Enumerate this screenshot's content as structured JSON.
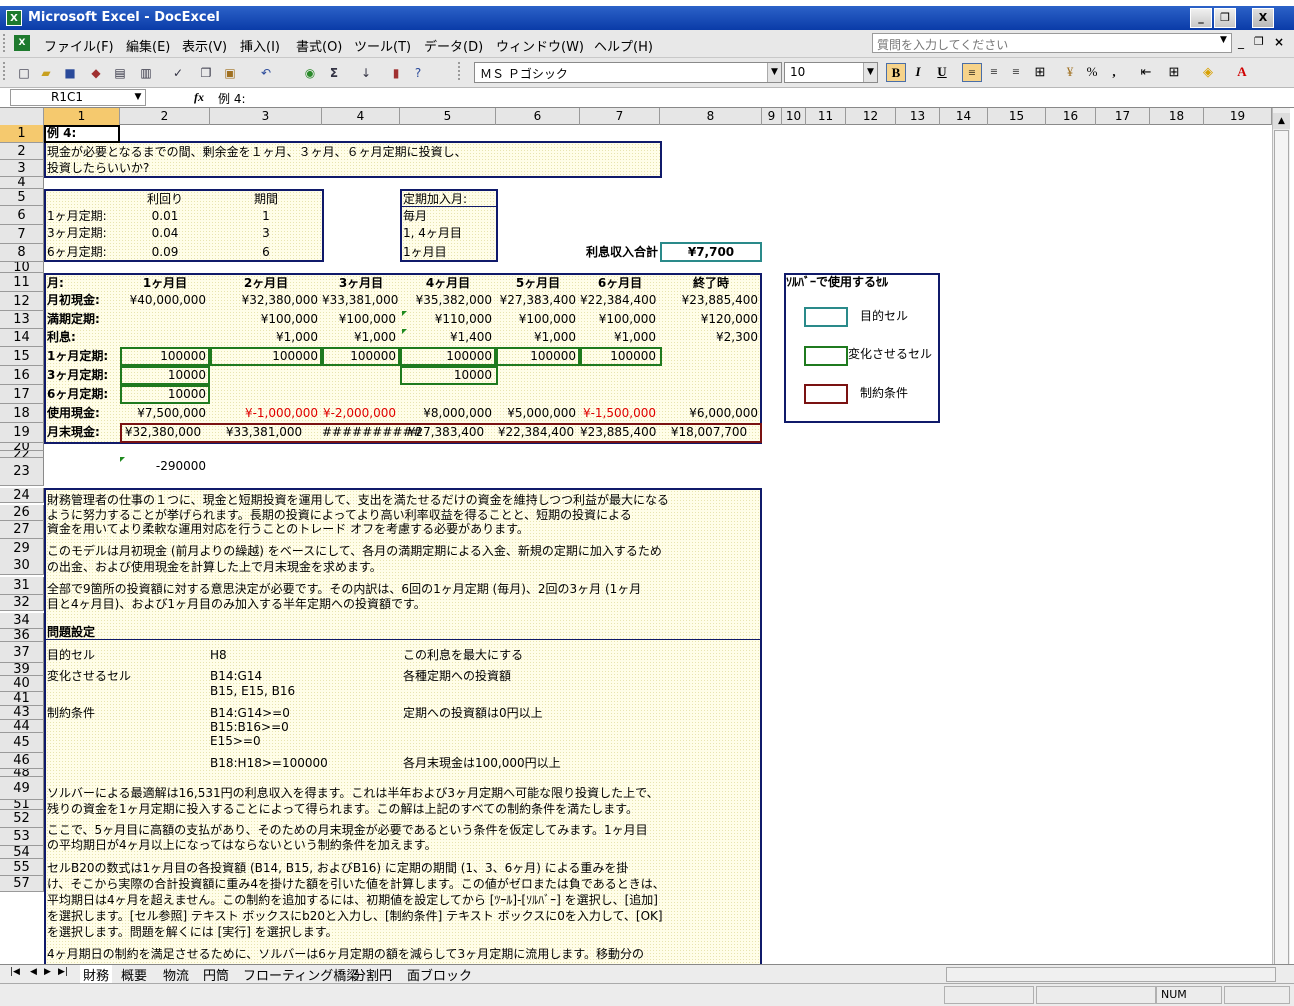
{
  "window": {
    "app_icon": "X",
    "title": "Microsoft Excel - DocExcel",
    "min": "_",
    "restore": "❐",
    "close": "X"
  },
  "menu": {
    "items": [
      "ファイル(F)",
      "編集(E)",
      "表示(V)",
      "挿入(I)",
      "書式(O)",
      "ツール(T)",
      "データ(D)",
      "ウィンドウ(W)",
      "ヘルプ(H)"
    ],
    "help_placeholder": "質問を入力してください",
    "sub_min": "_",
    "sub_restore": "❐",
    "sub_close": "×"
  },
  "toolbar": {
    "font": "ＭＳ Ｐゴシック",
    "size": "10",
    "bold": "B",
    "italic": "I",
    "underline": "U",
    "percent": "%",
    "comma": ","
  },
  "formula": {
    "name_box": "R1C1",
    "fx": "fx",
    "content": "例 4:"
  },
  "columns": [
    "1",
    "2",
    "3",
    "4",
    "5",
    "6",
    "7",
    "8",
    "9",
    "10",
    "11",
    "12",
    "13",
    "14",
    "15",
    "16",
    "17",
    "18",
    "19"
  ],
  "rows": [
    "1",
    "2",
    "3",
    "4",
    "5",
    "6",
    "7",
    "8",
    "10",
    "11",
    "12",
    "13",
    "14",
    "15",
    "16",
    "17",
    "18",
    "19",
    "20",
    "22",
    "23",
    "24",
    "26",
    "27",
    "29",
    "30",
    "31",
    "32",
    "34",
    "36",
    "37",
    "39",
    "40",
    "41",
    "43",
    "44",
    "45",
    "46",
    "48",
    "49",
    "51",
    "52",
    "53",
    "54",
    "55",
    "57"
  ],
  "cells": {
    "r1": "例 4:",
    "r2": "現金が必要となるまでの間、剰余金を１ヶ月、３ヶ月、６ヶ月定期に投資し、",
    "r3": "投資したらいいか?",
    "rate_hdr": "利回り",
    "term_hdr": "期間",
    "r6_lbl": "1ヶ月定期:",
    "r6_rate": "0.01",
    "r6_term": "1",
    "r7_lbl": "3ヶ月定期:",
    "r7_rate": "0.04",
    "r7_term": "3",
    "r8_lbl": "6ヶ月定期:",
    "r8_rate": "0.09",
    "r8_term": "6",
    "join_hdr": "定期加入月:",
    "join1": "毎月",
    "join2": "1, 4ヶ月目",
    "join3": "1ヶ月目",
    "interest_lbl": "利息収入合計",
    "interest_val": "¥7,700",
    "m_hdr": "月:",
    "m1": "1ヶ月目",
    "m2": "2ヶ月目",
    "m3": "3ヶ月目",
    "m4": "4ヶ月目",
    "m5": "5ヶ月目",
    "m6": "6ヶ月目",
    "m7": "終了時",
    "r11": {
      "lbl": "月初現金:",
      "v": [
        "¥40,000,000",
        "¥32,380,000",
        "¥33,381,000",
        "¥35,382,000",
        "¥27,383,400",
        "¥22,384,400",
        "¥23,885,400"
      ]
    },
    "r12": {
      "lbl": "満期定期:",
      "v": [
        "",
        "¥100,000",
        "¥100,000",
        "¥110,000",
        "¥100,000",
        "¥100,000",
        "¥120,000"
      ]
    },
    "r13": {
      "lbl": "利息:",
      "v": [
        "",
        "¥1,000",
        "¥1,000",
        "¥1,400",
        "¥1,000",
        "¥1,000",
        "¥2,300"
      ]
    },
    "r14": {
      "lbl": "1ヶ月定期:",
      "v": [
        "100000",
        "100000",
        "100000",
        "100000",
        "100000",
        "100000"
      ]
    },
    "r15": {
      "lbl": "3ヶ月定期:",
      "v": [
        "10000",
        "10000"
      ]
    },
    "r16": {
      "lbl": "6ヶ月定期:",
      "v": [
        "10000"
      ]
    },
    "r17": {
      "lbl": "使用現金:",
      "v": [
        "¥7,500,000",
        "¥-1,000,000",
        "¥-2,000,000",
        "¥8,000,000",
        "¥5,000,000",
        "¥-1,500,000",
        "¥6,000,000"
      ]
    },
    "r18": {
      "lbl": "月末現金:",
      "v": [
        "¥32,380,000",
        "¥33,381,000",
        "##########",
        "¥27,383,400",
        "¥22,384,400",
        "¥23,885,400",
        "¥18,007,700"
      ]
    },
    "r20": "-290000",
    "legend": {
      "title": "ｿﾙﾊﾞｰで使用するｾﾙ",
      "target": "目的セル",
      "change": "変化させるセル",
      "constraint": "制約条件"
    },
    "p22": "財務管理者の仕事の１つに、現金と短期投資を運用して、支出を満たせるだけの資金を維持しつつ利益が最大になる",
    "p23": "ように努力することが挙げられます。長期の投資によってより高い利率収益を得ることと、短期の投資による",
    "p24": "資金を用いてより柔軟な運用対応を行うことのトレード オフを考慮する必要があります。",
    "p26": "このモデルは月初現金 (前月よりの繰越) をベースにして、各月の満期定期による入金、新規の定期に加入するため",
    "p27": "の出金、および使用現金を計算した上で月末現金を求めます。",
    "p29": "全部で9箇所の投資額に対する意思決定が必要です。その内訳は、6回の1ヶ月定期 (毎月)、2回の3ヶ月 (1ヶ月",
    "p30": "目と4ヶ月目)、および1ヶ月目のみ加入する半年定期への投資額です。",
    "p32": "問題設定",
    "p34a": "目的セル",
    "p34b": "H8",
    "p34c": "この利息を最大にする",
    "p36a": "変化させるセル",
    "p36b": "B14:G14",
    "p36c": "各種定期への投資額",
    "p37b": "B15, E15, B16",
    "p39a": "制約条件",
    "p39b": "B14:G14>=0",
    "p39c": "定期への投資額は0円以上",
    "p40b": "B15:B16>=0",
    "p41b": "E15>=0",
    "p43b": "B18:H18>=100000",
    "p43c": "各月末現金は100,000円以上",
    "p45": "ソルバーによる最適解は16,531円の利息収入を得ます。これは半年および3ヶ月定期へ可能な限り投資した上で、",
    "p46": "残りの資金を1ヶ月定期に投入することによって得られます。この解は上記のすべての制約条件を満たします。",
    "p48": "ここで、5ヶ月目に高額の支払があり、そのための月末現金が必要であるという条件を仮定してみます。1ヶ月目",
    "p49": "の平均期日が4ヶ月以上になってはならないという制約条件を加えます。",
    "p51": "セルB20の数式は1ヶ月目の各投資額 (B14, B15, およびB16) に定期の期間 (1、3、6ヶ月) による重みを掛",
    "p52": "け、そこから実際の合計投資額に重み4を掛けた額を引いた値を計算します。この値がゼロまたは負であるときは、",
    "p53": "平均期日は4ヶ月を超えません。この制約を追加するには、初期値を設定してから [ﾂｰﾙ]-[ｿﾙﾊﾞｰ] を選択し、[追加]",
    "p54": "を選択します。[セル参照] テキスト ボックスにb20と入力し、[制約条件] テキスト ボックスに0を入力して、[OK]",
    "p55": "を選択します。問題を解くには [実行] を選択します。",
    "p57": "4ヶ月期日の制約を満足させるために、ソルバーは6ヶ月定期の額を減らして3ヶ月定期に流用します。移動分の"
  },
  "tabs": [
    "財務",
    "概要",
    "物流",
    "円筒",
    "フローティング橋梁",
    "分割円",
    "面ブロック"
  ],
  "status": {
    "num": "NUM"
  }
}
